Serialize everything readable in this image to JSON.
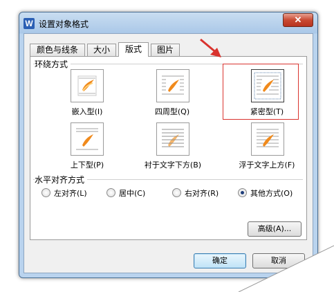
{
  "window": {
    "title": "设置对象格式",
    "app_icon_letter": "W",
    "close_symbol": "✕"
  },
  "tabs": [
    {
      "label": "颜色与线条",
      "active": false
    },
    {
      "label": "大小",
      "active": false
    },
    {
      "label": "版式",
      "active": true
    },
    {
      "label": "图片",
      "active": false
    }
  ],
  "wrap_section": {
    "title": "环绕方式",
    "options": [
      {
        "label": "嵌入型(I)",
        "icon": "inline-wrap-icon",
        "selected": false
      },
      {
        "label": "四周型(Q)",
        "icon": "square-wrap-icon",
        "selected": false
      },
      {
        "label": "紧密型(T)",
        "icon": "tight-wrap-icon",
        "selected": true
      },
      {
        "label": "上下型(P)",
        "icon": "top-bottom-wrap-icon",
        "selected": false
      },
      {
        "label": "衬于文字下方(B)",
        "icon": "behind-text-icon",
        "selected": false
      },
      {
        "label": "浮于文字上方(F)",
        "icon": "in-front-text-icon",
        "selected": false
      }
    ]
  },
  "align_section": {
    "title": "水平对齐方式",
    "options": [
      {
        "label": "左对齐(L)",
        "checked": false
      },
      {
        "label": "居中(C)",
        "checked": false
      },
      {
        "label": "右对齐(R)",
        "checked": false
      },
      {
        "label": "其他方式(O)",
        "checked": true
      }
    ]
  },
  "buttons": {
    "advanced": "高级(A)...",
    "ok": "确定",
    "cancel": "取消"
  },
  "colors": {
    "highlight_red": "#d9332e",
    "title_bar": "#aac8e8",
    "picture_orange": "#f08a1c"
  }
}
